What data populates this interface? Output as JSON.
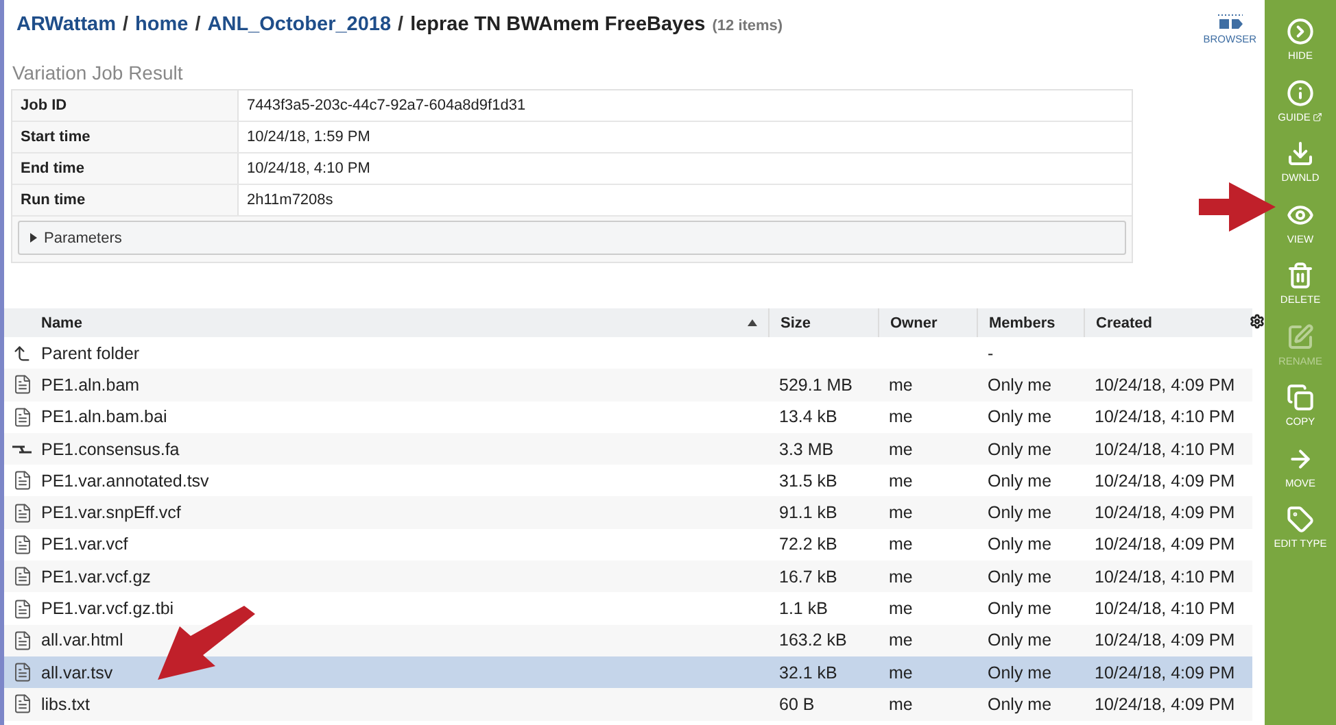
{
  "breadcrumb": {
    "links": [
      "ARWattam",
      "home",
      "ANL_October_2018"
    ],
    "separator": "/",
    "current": "leprae TN BWAmem FreeBayes",
    "count": "(12 items)"
  },
  "browser_button": {
    "label": "BROWSER"
  },
  "job": {
    "title": "Variation Job Result",
    "rows": [
      {
        "label": "Job ID",
        "value": "7443f3a5-203c-44c7-92a7-604a8d9f1d31"
      },
      {
        "label": "Start time",
        "value": "10/24/18, 1:59 PM"
      },
      {
        "label": "End time",
        "value": "10/24/18, 4:10 PM"
      },
      {
        "label": "Run time",
        "value": "2h11m7208s"
      }
    ],
    "parameters": {
      "label": "Parameters",
      "expanded": false
    }
  },
  "table": {
    "columns": [
      {
        "label": "Name",
        "sorted": true
      },
      {
        "label": "Size",
        "sorted": false
      },
      {
        "label": "Owner",
        "sorted": false
      },
      {
        "label": "Members",
        "sorted": false
      },
      {
        "label": "Created",
        "sorted": false
      }
    ],
    "rows": [
      {
        "kind": "parent",
        "name": "Parent folder",
        "members": "-",
        "selected": false
      },
      {
        "kind": "file",
        "name": "PE1.aln.bam",
        "size": "529.1 MB",
        "owner": "me",
        "members": "Only me",
        "created": "10/24/18, 4:09 PM",
        "selected": false
      },
      {
        "kind": "file",
        "name": "PE1.aln.bam.bai",
        "size": "13.4 kB",
        "owner": "me",
        "members": "Only me",
        "created": "10/24/18, 4:10 PM",
        "selected": false
      },
      {
        "kind": "contigs",
        "name": "PE1.consensus.fa",
        "size": "3.3 MB",
        "owner": "me",
        "members": "Only me",
        "created": "10/24/18, 4:10 PM",
        "selected": false
      },
      {
        "kind": "file",
        "name": "PE1.var.annotated.tsv",
        "size": "31.5 kB",
        "owner": "me",
        "members": "Only me",
        "created": "10/24/18, 4:09 PM",
        "selected": false
      },
      {
        "kind": "file",
        "name": "PE1.var.snpEff.vcf",
        "size": "91.1 kB",
        "owner": "me",
        "members": "Only me",
        "created": "10/24/18, 4:09 PM",
        "selected": false
      },
      {
        "kind": "file",
        "name": "PE1.var.vcf",
        "size": "72.2 kB",
        "owner": "me",
        "members": "Only me",
        "created": "10/24/18, 4:09 PM",
        "selected": false
      },
      {
        "kind": "file",
        "name": "PE1.var.vcf.gz",
        "size": "16.7 kB",
        "owner": "me",
        "members": "Only me",
        "created": "10/24/18, 4:10 PM",
        "selected": false
      },
      {
        "kind": "file",
        "name": "PE1.var.vcf.gz.tbi",
        "size": "1.1 kB",
        "owner": "me",
        "members": "Only me",
        "created": "10/24/18, 4:10 PM",
        "selected": false
      },
      {
        "kind": "file",
        "name": "all.var.html",
        "size": "163.2 kB",
        "owner": "me",
        "members": "Only me",
        "created": "10/24/18, 4:09 PM",
        "selected": false
      },
      {
        "kind": "file",
        "name": "all.var.tsv",
        "size": "32.1 kB",
        "owner": "me",
        "members": "Only me",
        "created": "10/24/18, 4:09 PM",
        "selected": true
      },
      {
        "kind": "file",
        "name": "libs.txt",
        "size": "60 B",
        "owner": "me",
        "members": "Only me",
        "created": "10/24/18, 4:09 PM",
        "selected": false
      }
    ]
  },
  "actions": [
    {
      "kind": "hide",
      "label": "HIDE",
      "disabled": false
    },
    {
      "kind": "guide",
      "label": "GUIDE",
      "disabled": false
    },
    {
      "kind": "download",
      "label": "DWNLD",
      "disabled": false
    },
    {
      "kind": "view",
      "label": "VIEW",
      "disabled": false
    },
    {
      "kind": "delete",
      "label": "DELETE",
      "disabled": false
    },
    {
      "kind": "rename",
      "label": "RENAME",
      "disabled": true
    },
    {
      "kind": "copy",
      "label": "COPY",
      "disabled": false
    },
    {
      "kind": "move",
      "label": "MOVE",
      "disabled": false
    },
    {
      "kind": "tag",
      "label": "EDIT TYPE",
      "disabled": false
    }
  ]
}
